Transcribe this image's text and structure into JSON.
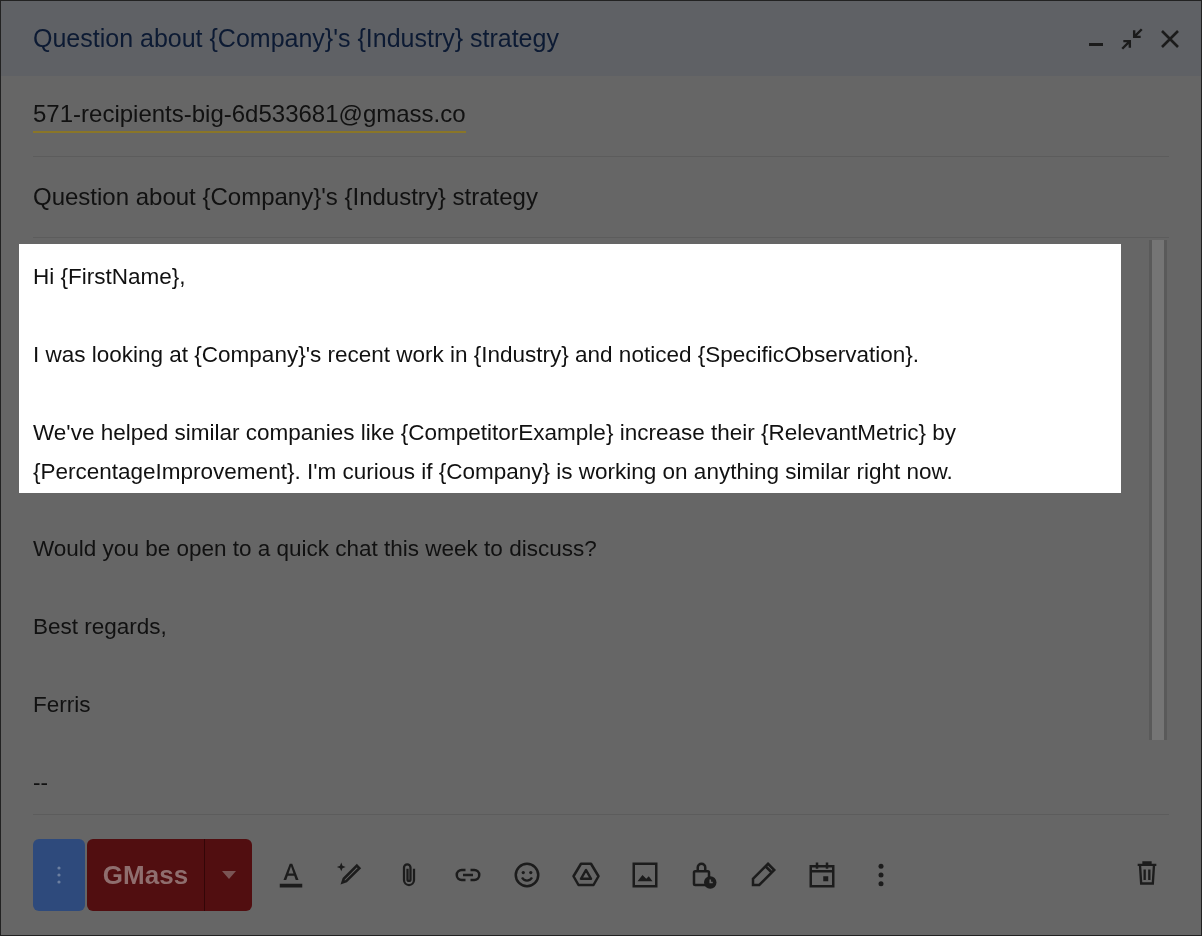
{
  "window": {
    "title": "Question about {Company}'s {Industry} strategy",
    "dimmed": true
  },
  "recipient": {
    "value": "571-recipients-big-6d533681@gmass.co"
  },
  "subject": {
    "value": "Question about {Company}'s {Industry} strategy"
  },
  "body": {
    "paragraphs": [
      {
        "text": "Hi {FirstName},",
        "highlighted": true
      },
      {
        "text": "I was looking at {Company}'s recent work in {Industry} and noticed {SpecificObservation}.",
        "highlighted": true
      },
      {
        "text": "We've helped similar companies like {CompetitorExample} increase their {RelevantMetric} by {PercentageImprovement}. I'm curious if {Company} is working on anything similar right now.",
        "highlighted": true
      },
      {
        "text": "Would you be open to a quick chat this week to discuss?",
        "highlighted": false
      },
      {
        "text": "Best regards,",
        "highlighted": false
      },
      {
        "text": "Ferris",
        "highlighted": false
      },
      {
        "text": "--",
        "highlighted": false
      }
    ]
  },
  "toolbar": {
    "send_label": "GMass"
  }
}
